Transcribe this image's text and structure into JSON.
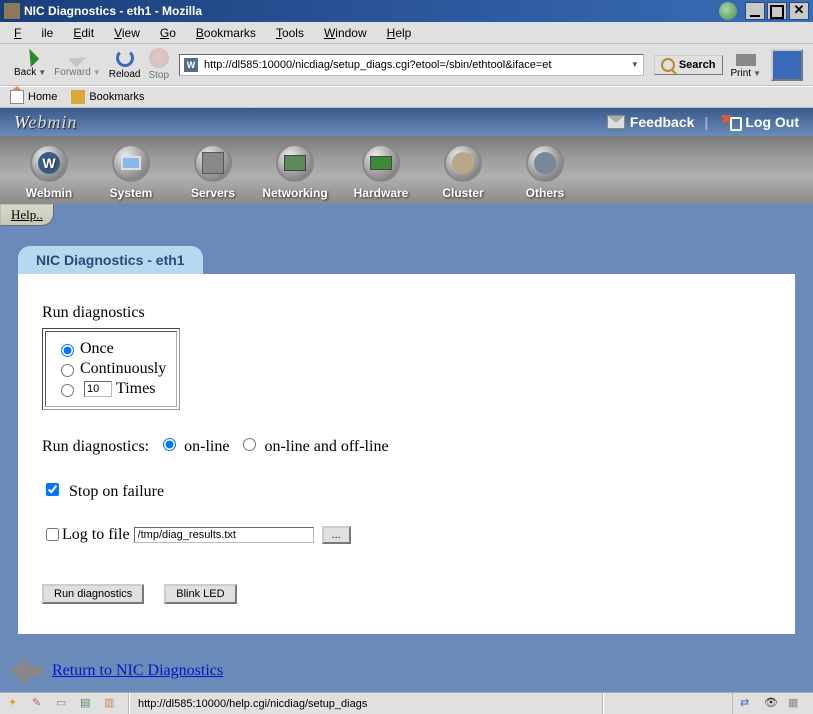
{
  "window": {
    "title": "NIC Diagnostics - eth1 - Mozilla"
  },
  "menus": {
    "file": "File",
    "edit": "Edit",
    "view": "View",
    "go": "Go",
    "bookmarks": "Bookmarks",
    "tools": "Tools",
    "window": "Window",
    "help": "Help"
  },
  "toolbar": {
    "back": "Back",
    "forward": "Forward",
    "reload": "Reload",
    "stop": "Stop",
    "url": "http://dl585:10000/nicdiag/setup_diags.cgi?etool=/sbin/ethtool&iface=et",
    "search": "Search",
    "print": "Print"
  },
  "personal": {
    "home": "Home",
    "bookmarks": "Bookmarks"
  },
  "webmin": {
    "logo": "Webmin",
    "feedback": "Feedback",
    "logout": "Log Out",
    "cats": {
      "webmin": "Webmin",
      "system": "System",
      "servers": "Servers",
      "networking": "Networking",
      "hardware": "Hardware",
      "cluster": "Cluster",
      "others": "Others"
    },
    "help": "Help.."
  },
  "page": {
    "section_title": "NIC Diagnostics - eth1",
    "run_label": "Run diagnostics",
    "opt_once": "Once",
    "opt_cont": "Continuously",
    "opt_times_n": "10",
    "opt_times_suffix": "Times",
    "mode_label": "Run diagnostics:",
    "mode_online": "on-line",
    "mode_both": "on-line and off-line",
    "stop_label": "Stop on failure",
    "log_label": "Log to file",
    "log_path": "/tmp/diag_results.txt",
    "browse_btn": "...",
    "run_btn": "Run diagnostics",
    "blink_btn": "Blink LED",
    "return_link": "Return to NIC Diagnostics"
  },
  "status": {
    "url": "http://dl585:10000/help.cgi/nicdiag/setup_diags"
  }
}
